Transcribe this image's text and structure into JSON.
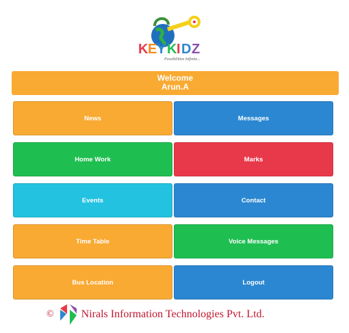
{
  "logo": {
    "brand": "KEYKIDZ",
    "tagline": "Possibilities Infinite..."
  },
  "welcome": {
    "line1": "Welcome",
    "line2": "Arun.A"
  },
  "tiles": [
    {
      "label": "News",
      "color": "#f9aa33"
    },
    {
      "label": "Messages",
      "color": "#2b87d1"
    },
    {
      "label": "Home Work",
      "color": "#1fbe51"
    },
    {
      "label": "Marks",
      "color": "#e8394a"
    },
    {
      "label": "Events",
      "color": "#22c2e0"
    },
    {
      "label": "Contact",
      "color": "#2b87d1"
    },
    {
      "label": "Time Table",
      "color": "#f9aa33"
    },
    {
      "label": "Voice Messages",
      "color": "#1fbe51"
    },
    {
      "label": "Bus Location",
      "color": "#f9aa33"
    },
    {
      "label": "Logout",
      "color": "#2b87d1"
    }
  ],
  "footer": {
    "copyright_symbol": "©",
    "company": "Nirals Information Technologies Pvt. Ltd."
  }
}
